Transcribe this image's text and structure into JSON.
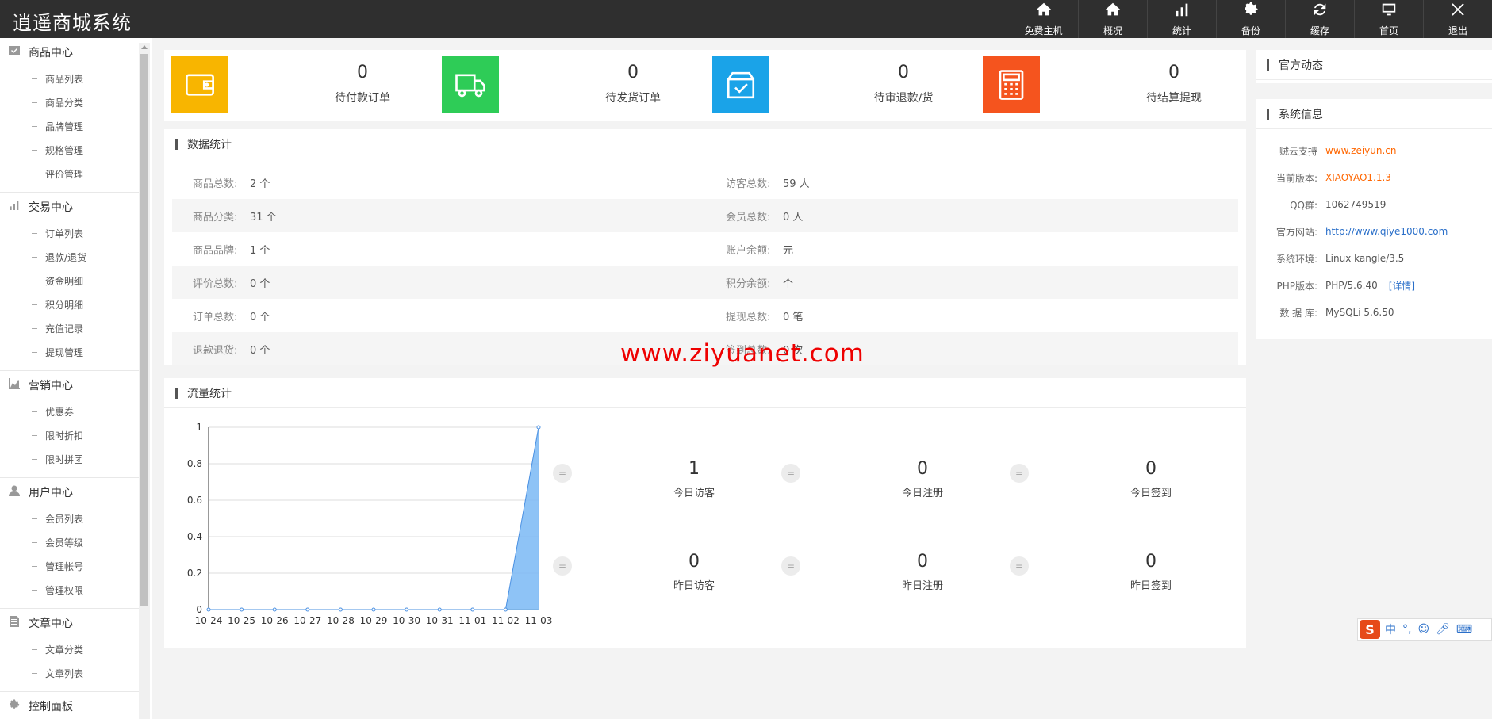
{
  "app": {
    "title": "逍遥商城系统"
  },
  "topnav": [
    {
      "label": "免费主机",
      "icon": "home-icon"
    },
    {
      "label": "概况",
      "icon": "home-icon"
    },
    {
      "label": "统计",
      "icon": "bar-chart-icon"
    },
    {
      "label": "备份",
      "icon": "gear-icon"
    },
    {
      "label": "缓存",
      "icon": "refresh-icon"
    },
    {
      "label": "首页",
      "icon": "monitor-icon"
    },
    {
      "label": "退出",
      "icon": "close-icon"
    }
  ],
  "sidebar": {
    "sections": [
      {
        "title": "商品中心",
        "icon": "check-box-icon",
        "items": [
          "商品列表",
          "商品分类",
          "品牌管理",
          "规格管理",
          "评价管理"
        ]
      },
      {
        "title": "交易中心",
        "icon": "bar-chart-icon",
        "items": [
          "订单列表",
          "退款/退货",
          "资金明细",
          "积分明细",
          "充值记录",
          "提现管理"
        ]
      },
      {
        "title": "营销中心",
        "icon": "area-chart-icon",
        "items": [
          "优惠券",
          "限时折扣",
          "限时拼团"
        ]
      },
      {
        "title": "用户中心",
        "icon": "user-icon",
        "items": [
          "会员列表",
          "会员等级",
          "管理帐号",
          "管理权限"
        ]
      },
      {
        "title": "文章中心",
        "icon": "document-icon",
        "items": [
          "文章分类",
          "文章列表"
        ]
      },
      {
        "title": "控制面板",
        "icon": "gear-icon",
        "items": []
      }
    ]
  },
  "top_stats": [
    {
      "value": "0",
      "label": "待付款订单",
      "color": "#f8b500",
      "icon": "wallet-icon"
    },
    {
      "value": "0",
      "label": "待发货订单",
      "color": "#2ecc57",
      "icon": "truck-icon"
    },
    {
      "value": "0",
      "label": "待审退款/货",
      "color": "#1aa3e8",
      "icon": "checked-box-icon"
    },
    {
      "value": "0",
      "label": "待结算提现",
      "color": "#f5541e",
      "icon": "calculator-icon"
    }
  ],
  "data_stats": {
    "title": "数据统计",
    "rows": [
      [
        {
          "k": "商品总数:",
          "v": "2 个"
        },
        {
          "k": "访客总数:",
          "v": "59 人"
        }
      ],
      [
        {
          "k": "商品分类:",
          "v": "31 个"
        },
        {
          "k": "会员总数:",
          "v": "0 人"
        }
      ],
      [
        {
          "k": "商品品牌:",
          "v": "1 个"
        },
        {
          "k": "账户余额:",
          "v": "元"
        }
      ],
      [
        {
          "k": "评价总数:",
          "v": "0 个"
        },
        {
          "k": "积分余额:",
          "v": "个"
        }
      ],
      [
        {
          "k": "订单总数:",
          "v": "0 个"
        },
        {
          "k": "提现总数:",
          "v": "0 笔"
        }
      ],
      [
        {
          "k": "退款退货:",
          "v": "0 个"
        },
        {
          "k": "签到总数:",
          "v": "0 次"
        }
      ]
    ]
  },
  "traffic": {
    "title": "流量统计",
    "eq_symbol": "=",
    "stats": [
      {
        "value": "1",
        "label": "今日访客"
      },
      {
        "value": "0",
        "label": "今日注册"
      },
      {
        "value": "0",
        "label": "今日签到"
      },
      {
        "value": "0",
        "label": "昨日访客"
      },
      {
        "value": "0",
        "label": "昨日注册"
      },
      {
        "value": "0",
        "label": "昨日签到"
      }
    ]
  },
  "chart_data": {
    "type": "area",
    "categories": [
      "10-24",
      "10-25",
      "10-26",
      "10-27",
      "10-28",
      "10-29",
      "10-30",
      "10-31",
      "11-01",
      "11-02",
      "11-03"
    ],
    "values": [
      0,
      0,
      0,
      0,
      0,
      0,
      0,
      0,
      0,
      0,
      1
    ],
    "ylim": [
      0,
      1
    ],
    "yticks": [
      "0",
      "0.2",
      "0.4",
      "0.6",
      "0.8",
      "1"
    ],
    "grid": true,
    "color": "#7ab8f5"
  },
  "right_news": {
    "title": "官方动态"
  },
  "sysinfo": {
    "title": "系统信息",
    "rows": [
      {
        "k": "贼云支持",
        "v": "www.zeiyun.cn",
        "style": "orange"
      },
      {
        "k": "当前版本:",
        "v": "XIAOYAO1.1.3",
        "style": "orange"
      },
      {
        "k": "QQ群:",
        "v": "1062749519",
        "style": ""
      },
      {
        "k": "官方网站:",
        "v": "http://www.qiye1000.com",
        "style": "blue"
      },
      {
        "k": "系统环境:",
        "v": "Linux kangle/3.5",
        "style": ""
      },
      {
        "k": "PHP版本:",
        "v": "PHP/5.6.40",
        "style": "",
        "more": "[详情]"
      },
      {
        "k": "数 据 库:",
        "v": "MySQLi 5.6.50",
        "style": ""
      }
    ]
  },
  "watermark": "www.ziyuanet.com",
  "ime": {
    "logo": "S",
    "mode": "中",
    "punct": "°,"
  }
}
